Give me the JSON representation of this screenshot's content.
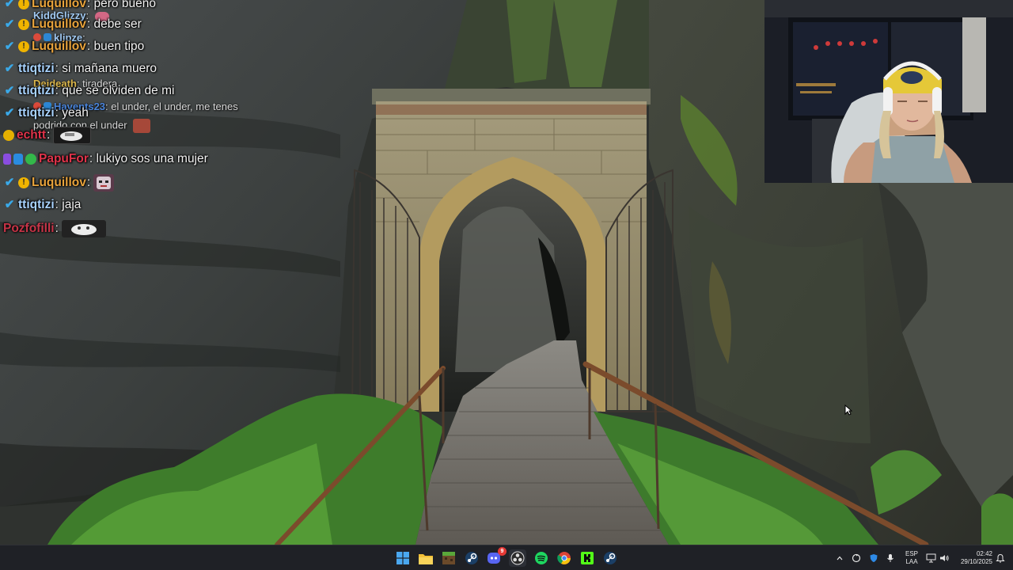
{
  "chat": {
    "messages": [
      {
        "user": "Luquillov",
        "sep": ":",
        "text": "pero bueno"
      },
      {
        "user": "Luquillov",
        "sep": ":",
        "text": "debe ser"
      },
      {
        "user": "Luquillov",
        "sep": ":",
        "text": "buen tipo"
      },
      {
        "user": "ttiqtizi",
        "sep": ":",
        "text": "si mañana muero"
      },
      {
        "user": "ttiqtizi",
        "sep": ":",
        "text": "que se olviden de mi"
      },
      {
        "user": "ttiqtizi",
        "sep": ":",
        "text": "yeah"
      },
      {
        "user": "echtt",
        "sep": ":",
        "text": ""
      },
      {
        "user": "PapuFor",
        "sep": ":",
        "text": "lukiyo sos una mujer"
      },
      {
        "user": "Luquillov",
        "sep": ":",
        "text": ""
      },
      {
        "user": "ttiqtizi",
        "sep": ":",
        "text": "jaja"
      },
      {
        "user": "Pozfofilli",
        "sep": ":",
        "text": ""
      }
    ],
    "ghosts": [
      {
        "user": "KiddGlizzy",
        "sep": ":",
        "text": ""
      },
      {
        "user": "klipze",
        "sep": ":",
        "text": ""
      },
      {
        "user": "Deideath",
        "sep": ":",
        "text": "tiradera"
      },
      {
        "user": "Havents23",
        "sep": ":",
        "text": "el under, el under, me tenes"
      },
      {
        "user": "",
        "sep": "",
        "text": "podrido con el under"
      }
    ]
  },
  "taskbar": {
    "language": {
      "line1": "ESP",
      "line2": "LAA"
    },
    "clock": {
      "time": "02:42",
      "date": "29/10/2025"
    },
    "apps": [
      "windows-start",
      "file-explorer",
      "minecraft",
      "steam",
      "discord",
      "obs",
      "spotify",
      "chrome",
      "kick",
      "steam-alt"
    ],
    "discord_badge": "9"
  },
  "colors": {
    "taskbar_bg": "#1f2126",
    "chat_orange": "#e8a33c",
    "chat_blue_name": "#a8d3ff",
    "chat_red_name": "#e0334a",
    "verified_check": "#3aa9e8"
  }
}
